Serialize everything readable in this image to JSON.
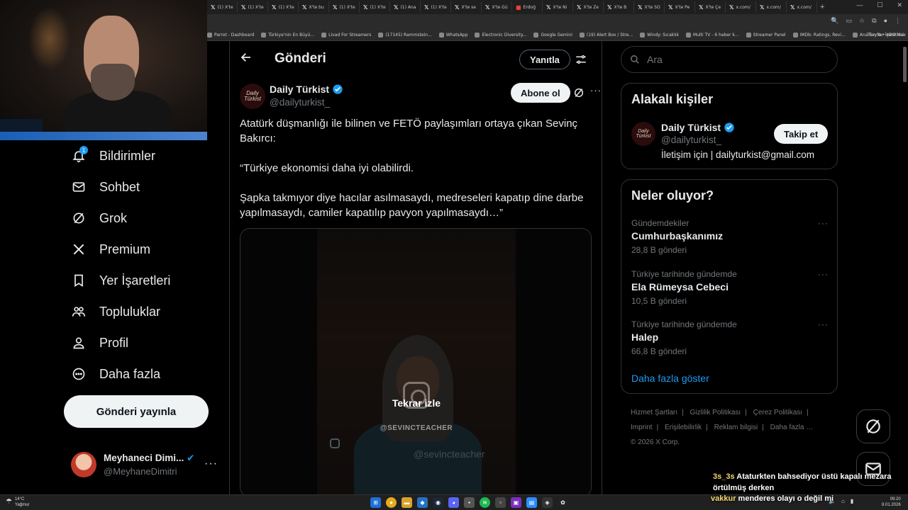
{
  "browser": {
    "tabs": [
      {
        "label": "(1) X'te",
        "icon": "x-logo-icon"
      },
      {
        "label": "(1) X'te",
        "icon": "x-logo-icon"
      },
      {
        "label": "(1) X'te",
        "icon": "x-logo-icon"
      },
      {
        "label": "X'te bu",
        "icon": "x-logo-icon"
      },
      {
        "label": "(1) X'te",
        "icon": "x-logo-icon"
      },
      {
        "label": "(1) X'te",
        "icon": "x-logo-icon"
      },
      {
        "label": "(1) Ana",
        "icon": "x-logo-icon"
      },
      {
        "label": "(1) X'te",
        "icon": "x-logo-icon"
      },
      {
        "label": "X'te se",
        "icon": "x-logo-icon"
      },
      {
        "label": "X'te Gü",
        "icon": "x-logo-icon"
      },
      {
        "label": "Erdoğ",
        "icon": "gmail-icon"
      },
      {
        "label": "X'te Ni",
        "icon": "x-logo-icon"
      },
      {
        "label": "X'te Ze",
        "icon": "x-logo-icon"
      },
      {
        "label": "X'te B",
        "icon": "x-logo-icon"
      },
      {
        "label": "X'te SO",
        "icon": "x-logo-icon"
      },
      {
        "label": "X'te Pe",
        "icon": "x-logo-icon"
      },
      {
        "label": "X'te Çe",
        "icon": "x-logo-icon"
      },
      {
        "label": "x.com/",
        "icon": "x-logo-icon"
      },
      {
        "label": "x.com/",
        "icon": "x-logo-icon"
      },
      {
        "label": "x.com/",
        "icon": "x-logo-icon"
      }
    ],
    "bookmarks": [
      "Parrot - Dashboard",
      "Türkiye'nin En Büyü...",
      "Livad For Streamers",
      "(17145) Rammstein...",
      "WhatsApp",
      "Electronic Diversity...",
      "Google Gemini",
      "(19) Alert Box / Stre...",
      "Windy: Sıcaklık",
      "Multi TV - 6 haber k...",
      "Streamer Panel",
      "IMDb: Ratings, Revi...",
      "Ana Sayfa • HBO Max"
    ],
    "bookmarks_more": "Tüm Yer İşaretleri"
  },
  "nav": {
    "notifications_badge": "1",
    "items": [
      {
        "label": "Bildirimler",
        "icon": "bell-icon"
      },
      {
        "label": "Sohbet",
        "icon": "mail-icon"
      },
      {
        "label": "Grok",
        "icon": "grok-icon"
      },
      {
        "label": "Premium",
        "icon": "x-logo-icon"
      },
      {
        "label": "Yer İşaretleri",
        "icon": "bookmark-icon"
      },
      {
        "label": "Topluluklar",
        "icon": "communities-icon"
      },
      {
        "label": "Profil",
        "icon": "profile-icon"
      },
      {
        "label": "Daha fazla",
        "icon": "more-circle-icon"
      }
    ],
    "post_button": "Gönderi yayınla",
    "account": {
      "name": "Meyhaneci Dimi...",
      "handle": "@MeyhaneDimitri"
    }
  },
  "main": {
    "title": "Gönderi",
    "reply_button": "Yanıtla",
    "author": {
      "name": "Daily Türkist",
      "handle": "@dailyturkist_",
      "avatar_text": "Daily Türkist"
    },
    "subscribe_button": "Abone ol",
    "text": {
      "p1": "Atatürk düşmanlığı ile bilinen ve FETÖ paylaşımları ortaya çıkan Sevinç Bakırcı:",
      "p2": "“Türkiye ekonomisi daha iyi olabilirdi.",
      "p3": "Şapka takmıyor diye hacılar asılmasaydı, medreseleri kapatıp dine darbe yapılmasaydı, camiler kapatılıp pavyon yapılmasaydı…”"
    },
    "media": {
      "replay_label": "Tekrar izle",
      "watermark_1": "@SEVINCTEACHER",
      "watermark_2": "@sevincteacher"
    }
  },
  "right": {
    "search_placeholder": "Ara",
    "related": {
      "title": "Alakalı kişiler",
      "name": "Daily Türkist",
      "handle": "@dailyturkist_",
      "bio": "İletişim için | dailyturkist@gmail.com",
      "follow_button": "Takip et"
    },
    "trends": {
      "title": "Neler oluyor?",
      "items": [
        {
          "context": "Gündemdekiler",
          "title": "Cumhurbaşkanımız",
          "count": "28,8 B gönderi"
        },
        {
          "context": "Türkiye tarihinde gündemde",
          "title": "Ela Rümeysa Cebeci",
          "count": "10,5 B gönderi"
        },
        {
          "context": "Türkiye tarihinde gündemde",
          "title": "Halep",
          "count": "66,8 B gönderi"
        }
      ],
      "show_more": "Daha fazla göster"
    },
    "footer": {
      "links": [
        "Hizmet Şartları",
        "Gizlilik Politikası",
        "Çerez Politikası",
        "Imprint",
        "Erişilebilirlik",
        "Reklam bilgisi",
        "Daha fazla …"
      ],
      "copyright": "© 2026 X Corp."
    }
  },
  "chat": [
    {
      "user": "3s_3s",
      "message": "Ataturkten bahsediyor üstü kapalı mezara örtülmüş derken"
    },
    {
      "user": "vakkur",
      "message": "menderes olayı o değil mi"
    }
  ],
  "taskbar": {
    "temp": "14°C",
    "condition": "Yağmur",
    "time": "09:20",
    "date": "8.01.2026"
  },
  "colors": {
    "accent": "#1d9bf0",
    "background": "#000000",
    "border": "#2f3336",
    "muted": "#71767b"
  }
}
